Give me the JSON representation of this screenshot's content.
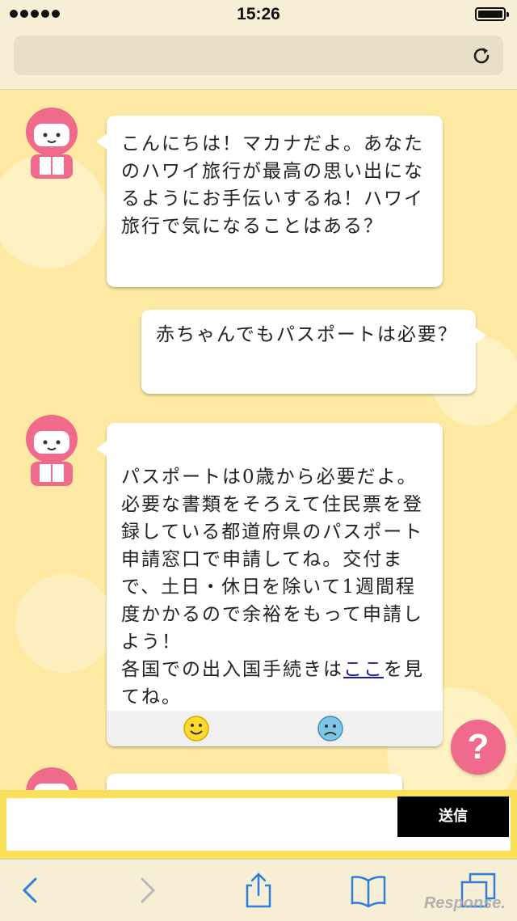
{
  "status_bar": {
    "time": "15:26"
  },
  "messages": [
    {
      "sender": "bot",
      "text": "こんにちは！マカナだよ。あなたのハワイ旅行が最高の思い出になるようにお手伝いするね！ハワイ旅行で気になることはある？"
    },
    {
      "sender": "user",
      "text": "赤ちゃんでもパスポートは必要？"
    },
    {
      "sender": "bot",
      "text_before_link": "パスポートは0歳から必要だよ。必要な書類をそろえて住民票を登録している都道府県のパスポート申請窓口で申請してね。交付まで、土日・休日を除いて1週間程度かかるので余裕をもって申請しよう！\n各国での出入国手続きは",
      "link_text": "ここ",
      "text_after_link": "を見てね。"
    }
  ],
  "feedback": {
    "positive_icon": "smile-icon",
    "negative_icon": "sad-face-icon"
  },
  "help_button": {
    "label": "?"
  },
  "input": {
    "value": "",
    "send_label": "送信"
  },
  "watermark": "Response.",
  "colors": {
    "chat_bg": "#fde9a2",
    "accent_pink": "#f06a8c",
    "input_bar": "#f9df5a",
    "send_button": "#000000"
  }
}
